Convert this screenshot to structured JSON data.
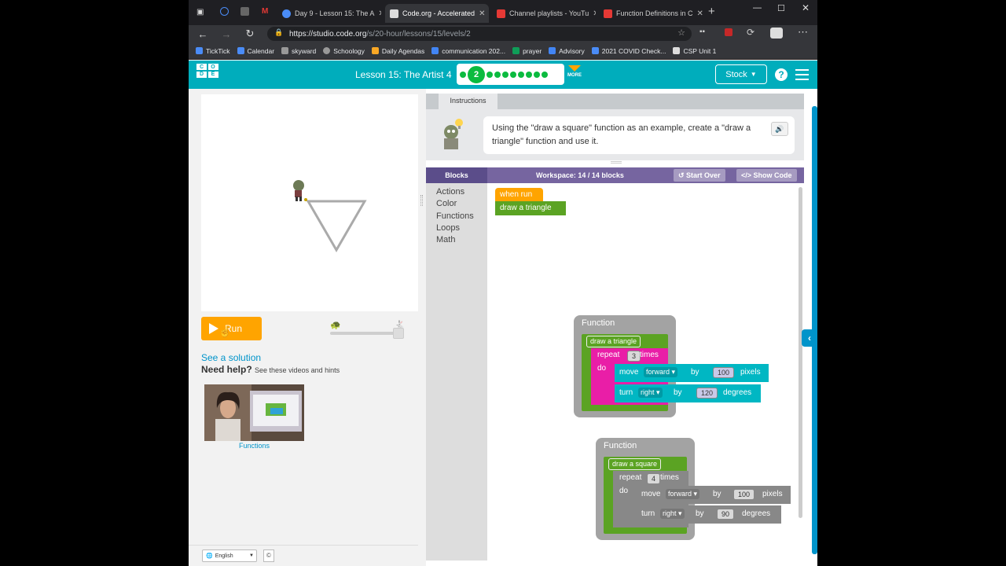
{
  "browser": {
    "tabs": [
      {
        "label": "Day 9 - Lesson 15: The A",
        "fav": "#4a8cf7"
      },
      {
        "label": "Code.org - Accelerated",
        "fav": "#ddd"
      },
      {
        "label": "Channel playlists - YouTu",
        "fav": "#e53935"
      },
      {
        "label": "Function Definitions in C",
        "fav": "#e53935"
      }
    ],
    "url_host": "https://studio.code.org",
    "url_path": "/s/20-hour/lessons/15/levels/2",
    "bookmarks": [
      {
        "label": "TickTick",
        "color": "#4a8cf7"
      },
      {
        "label": "Calendar",
        "color": "#4a8cf7"
      },
      {
        "label": "skyward",
        "color": "#888"
      },
      {
        "label": "Schoology",
        "color": "#888"
      },
      {
        "label": "Daily Agendas",
        "color": "#f9a825"
      },
      {
        "label": "communication 202...",
        "color": "#4285f4"
      },
      {
        "label": "prayer",
        "color": "#0f9d58"
      },
      {
        "label": "Advisory",
        "color": "#4285f4"
      },
      {
        "label": "2021 COVID Check...",
        "color": "#4a8cf7"
      },
      {
        "label": "CSP Unit 1",
        "color": "#ddd"
      }
    ]
  },
  "header": {
    "logo_letters": [
      "C",
      "O",
      "D",
      "E"
    ],
    "lesson_title": "Lesson 15: The Artist 4",
    "current_level": "2",
    "more_label": "MORE",
    "stock_label": "Stock",
    "help_label": "?"
  },
  "left": {
    "run_label": "Run",
    "see_solution": "See a solution",
    "need_help": "Need help?",
    "need_help_sub": "See these videos and hints",
    "video_label": "Functions",
    "language": "English",
    "copyright": "©"
  },
  "instructions": {
    "tab_label": "Instructions",
    "text": "Using the \"draw a square\" function as an example, create a \"draw a triangle\" function and use it."
  },
  "workspace": {
    "blocks_label": "Blocks",
    "count_label": "Workspace: 14 / 14 blocks",
    "start_over": "Start Over",
    "show_code": "Show Code",
    "categories": [
      "Actions",
      "Color",
      "Functions",
      "Loops",
      "Math"
    ],
    "when_run": "when run",
    "call_triangle": "draw a triangle",
    "fn1": {
      "header": "Function",
      "name": "draw a triangle",
      "repeat_word": "repeat",
      "repeat_count": "3",
      "times": "times",
      "do": "do",
      "move_word": "move",
      "move_dir": "forward ▾",
      "by": "by",
      "move_amount": "100",
      "pixels": "pixels",
      "turn_word": "turn",
      "turn_dir": "right ▾",
      "turn_amount": "120",
      "degrees": "degrees"
    },
    "fn2": {
      "header": "Function",
      "name": "draw a square",
      "repeat_word": "repeat",
      "repeat_count": "4",
      "times": "times",
      "do": "do",
      "move_word": "move",
      "move_dir": "forward ▾",
      "by": "by",
      "move_amount": "100",
      "pixels": "pixels",
      "turn_word": "turn",
      "turn_dir": "right ▾",
      "turn_amount": "90",
      "degrees": "degrees"
    }
  },
  "colors": {
    "codeorg_teal": "#00adbc",
    "run_orange": "#ffa400",
    "progress_green": "#0bbb3f",
    "blockly_purple": "#7665a0"
  }
}
